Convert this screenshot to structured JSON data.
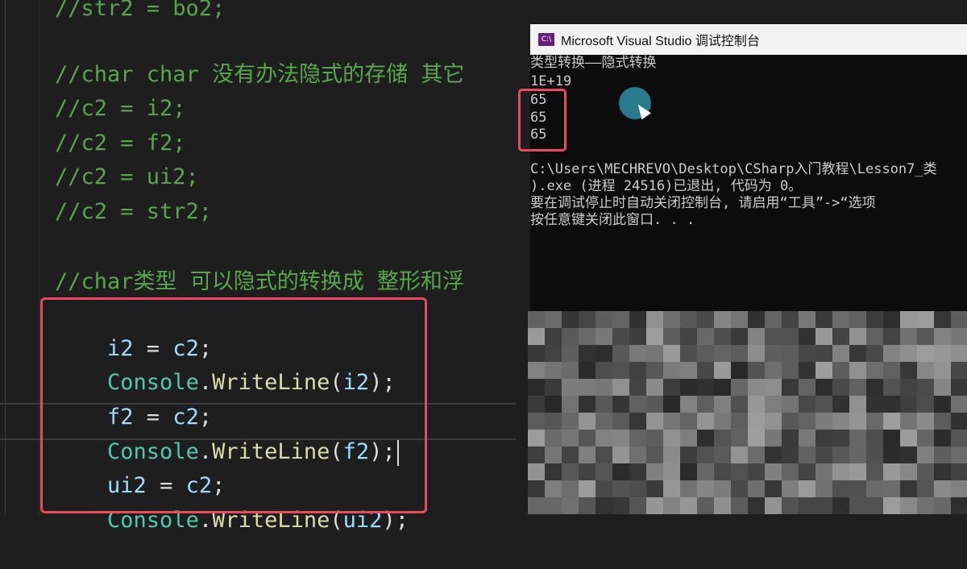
{
  "editor": {
    "lines": {
      "l0": "//str2 = bo2;",
      "l1": "//char char 没有办法隐式的存储 其它",
      "l2": "//c2 = i2;",
      "l3": "//c2 = f2;",
      "l4": "//c2 = ui2;",
      "l5": "//c2 = str2;",
      "l6": "//char类型 可以隐式的转换成 整形和浮",
      "l7_var": "i2",
      "l7_rest": " = ",
      "l7_var2": "c2",
      "l7_end": ";",
      "l8_cls": "Console",
      "l8_dot": ".",
      "l8_method": "WriteLine",
      "l8_open": "(",
      "l8_arg": "i2",
      "l8_close": ");",
      "l9_var": "f2",
      "l9_rest": " = ",
      "l9_var2": "c2",
      "l9_end": ";",
      "l10_cls": "Console",
      "l10_dot": ".",
      "l10_method": "WriteLine",
      "l10_open": "(",
      "l10_arg": "f2",
      "l10_close": ");",
      "l11_var": "ui2",
      "l11_rest": " = ",
      "l11_var2": "c2",
      "l11_end": ";",
      "l12_cls": "Console",
      "l12_dot": ".",
      "l12_method": "WriteLine",
      "l12_open": "(",
      "l12_arg": "ui2",
      "l12_close": ");"
    }
  },
  "console": {
    "title": "Microsoft Visual Studio 调试控制台",
    "icon_label": "C:\\",
    "output": [
      "类型转换——隐式转换",
      "1E+19",
      "65",
      "65",
      "65",
      "",
      "C:\\Users\\MECHREVO\\Desktop\\CSharp入门教程\\Lesson7_类",
      ").exe (进程 24516)已退出, 代码为 0。",
      "要在调试停止时自动关闭控制台, 请启用“工具”->“选项",
      "按任意键关闭此窗口. . ."
    ]
  },
  "colors": {
    "highlight": "#e84c5c",
    "comment": "#57a64a",
    "variable": "#9cdcfe",
    "class": "#4ec9b0",
    "method": "#dcdcaa"
  }
}
